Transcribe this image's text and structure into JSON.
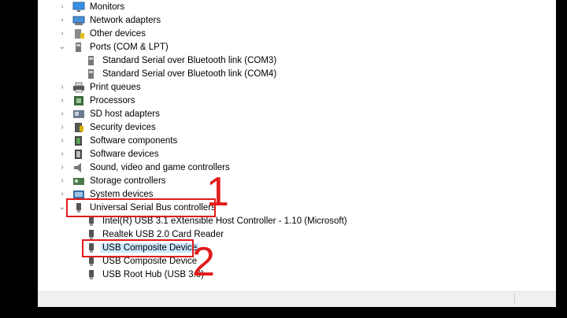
{
  "tree": {
    "categories_top": [
      {
        "label": "Monitors",
        "icon": "monitor-icon",
        "y": 0
      },
      {
        "label": "Network adapters",
        "icon": "network-adapter-icon",
        "y": 17
      },
      {
        "label": "Other devices",
        "icon": "unknown-device-icon",
        "y": 34
      }
    ],
    "ports": {
      "label": "Ports (COM & LPT)",
      "children": [
        "Standard Serial over Bluetooth link (COM3)",
        "Standard Serial over Bluetooth link (COM4)"
      ]
    },
    "categories_mid": [
      {
        "label": "Print queues",
        "icon": "printer-icon"
      },
      {
        "label": "Processors",
        "icon": "processor-icon"
      },
      {
        "label": "SD host adapters",
        "icon": "sd-card-icon"
      },
      {
        "label": "Security devices",
        "icon": "security-device-icon"
      },
      {
        "label": "Software components",
        "icon": "software-component-icon"
      },
      {
        "label": "Software devices",
        "icon": "software-device-icon"
      },
      {
        "label": "Sound, video and game controllers",
        "icon": "speaker-icon"
      },
      {
        "label": "Storage controllers",
        "icon": "storage-controller-icon"
      },
      {
        "label": "System devices",
        "icon": "system-devices-icon"
      }
    ],
    "usb": {
      "label": "Universal Serial Bus controllers",
      "children": [
        "Intel(R) USB 3.1 eXtensible Host Controller - 1.10 (Microsoft)",
        "Realtek USB 2.0 Card Reader",
        "USB Composite Device",
        "USB Composite Device",
        "USB Root Hub (USB 3.0)"
      ],
      "selected_index": 2
    }
  },
  "annotations": {
    "marker_1": "1",
    "marker_2": "2"
  },
  "colors": {
    "highlight": "#e21b1b",
    "selection": "#cce8ff"
  }
}
